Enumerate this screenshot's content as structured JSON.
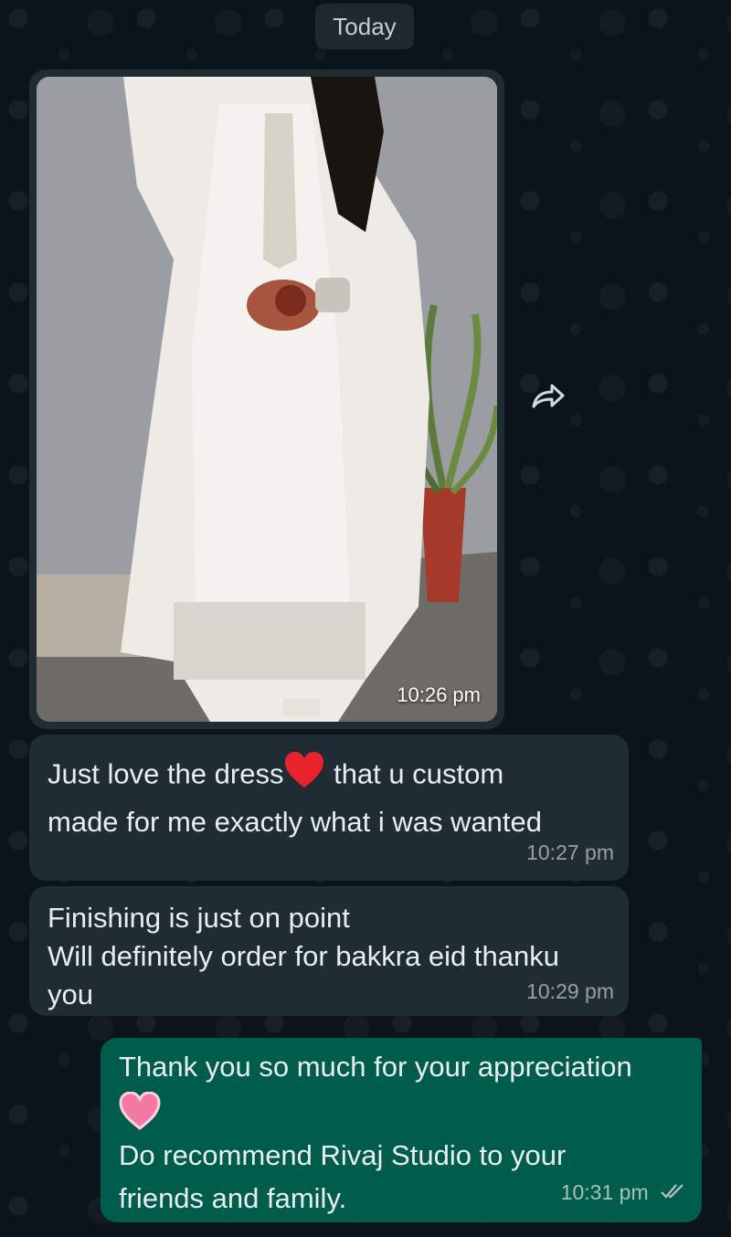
{
  "date_divider": "Today",
  "messages": [
    {
      "type": "image",
      "direction": "incoming",
      "time": "10:26 pm"
    },
    {
      "type": "text",
      "direction": "incoming",
      "line1_before_emoji": "Just love the dress",
      "emoji": "red-heart",
      "line1_after_emoji": " that u custom",
      "line2": "made for me exactly what i was wanted",
      "time": "10:27 pm"
    },
    {
      "type": "text",
      "direction": "incoming",
      "line1": "Finishing is just on point",
      "line2": "Will definitely order for bakkra eid thanku",
      "line3": "you",
      "time": "10:29 pm"
    },
    {
      "type": "text",
      "direction": "outgoing",
      "line1": "Thank you so much for your appreciation",
      "emoji": "pink-heart",
      "line3": "Do recommend Rivaj Studio to your",
      "line4": "friends and family.",
      "time": "10:31 pm",
      "status": "read-double-tick"
    }
  ],
  "colors": {
    "background": "#0b141a",
    "incoming_bubble": "#1f2c34",
    "outgoing_bubble": "#005c4b",
    "text": "#e9edef"
  },
  "icons": {
    "forward": "forward-arrow-icon",
    "read_receipt": "double-check-icon"
  }
}
